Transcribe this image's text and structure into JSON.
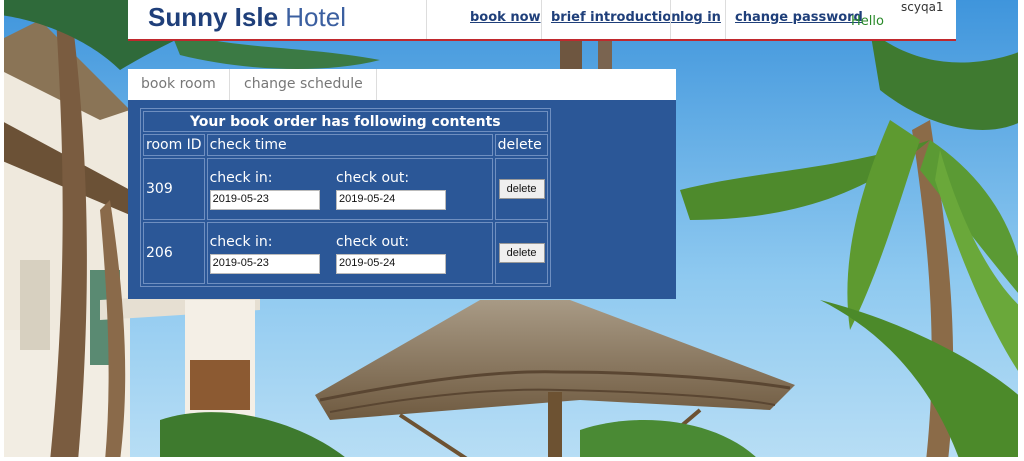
{
  "header": {
    "brand_bold": "Sunny Isle",
    "brand_light": "Hotel",
    "nav": [
      "book now",
      "brief introduction",
      "log in",
      "change password"
    ],
    "hello": "Hello",
    "username": "scyqa1"
  },
  "tabs": [
    "book room",
    "change schedule"
  ],
  "orders": {
    "caption": "Your book order has following contents",
    "col_room": "room ID",
    "col_time": "check time",
    "col_delete": "delete",
    "check_in_label": "check in:",
    "check_out_label": "check out:",
    "delete_label": "delete",
    "rows": [
      {
        "room": "309",
        "check_in": "2019-05-23",
        "check_out": "2019-05-24"
      },
      {
        "room": "206",
        "check_in": "2019-05-23",
        "check_out": "2019-05-24"
      }
    ]
  }
}
